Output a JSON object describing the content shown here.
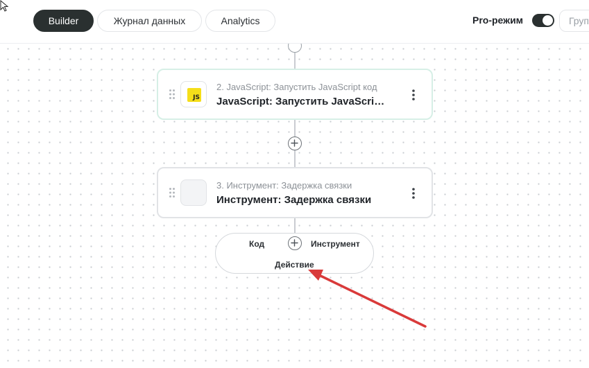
{
  "header": {
    "tabs": [
      {
        "label": "Builder",
        "active": true
      },
      {
        "label": "Журнал данных",
        "active": false
      },
      {
        "label": "Analytics",
        "active": false
      }
    ],
    "pro_mode": {
      "label": "Pro-режим",
      "enabled": true
    },
    "group_button": {
      "label": "Груп"
    }
  },
  "flow": {
    "steps": [
      {
        "subtitle": "2. JavaScript: Запустить JavaScript код",
        "title": "JavaScript: Запустить JavaScript код",
        "icon": "javascript-icon",
        "icon_text": "JS",
        "icon_color": "#f5de19"
      },
      {
        "subtitle": "3. Инструмент: Задержка связки",
        "title": "Инструмент: Задержка связки",
        "icon": "tool-placeholder-icon"
      }
    ],
    "add_menu": {
      "options": [
        "Код",
        "Инструмент",
        "Действие"
      ]
    }
  },
  "colors": {
    "accent_dark": "#2a3030",
    "annotation_arrow": "#d93a3a",
    "selected_card_border": "#d6efe6"
  }
}
